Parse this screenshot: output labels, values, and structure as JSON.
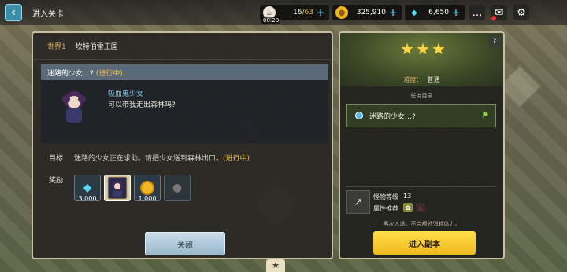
{
  "header": {
    "title": "进入关卡",
    "resources": {
      "stamina": {
        "value": "16",
        "max": "/63",
        "timer": "00:28"
      },
      "gold": {
        "value": "325,910"
      },
      "gems": {
        "value": "6,650"
      }
    }
  },
  "quest": {
    "world_tag": "世界1",
    "world_name": "坎特伯雷王国",
    "title": "迷路的少女…?",
    "status": "(进行中)",
    "npc_name": "吸血鬼少女",
    "npc_line": "可以带我走出森林吗?",
    "objective_label": "目标",
    "objective_text": "迷路的少女正在求助。请把少女送到森林出口。",
    "objective_status": "(进行中)",
    "rewards_label": "奖励",
    "rewards": [
      {
        "icon": "gem-icon",
        "amount": "3,000"
      },
      {
        "icon": "hero-card-icon",
        "amount": ""
      },
      {
        "icon": "gold-coin-icon",
        "amount": "1,000"
      },
      {
        "icon": "companion-icon",
        "amount": ""
      }
    ],
    "close_label": "关闭"
  },
  "stage": {
    "stars": 3,
    "difficulty_label": "难度：",
    "difficulty_value": "普通",
    "tasks_title": "任务目录",
    "task_item": "迷路的少女…?",
    "monster_level_label": "怪物等级",
    "monster_level_value": "13",
    "recommended_attr_label": "属性推荐",
    "note": "再次入场，不会额外消耗体力。",
    "enter_label": "进入副本",
    "help_label": "?"
  },
  "colors": {
    "accent_yellow": "#ffd84a",
    "in_progress": "#f0c040",
    "npc_name": "#7ec8ee"
  }
}
